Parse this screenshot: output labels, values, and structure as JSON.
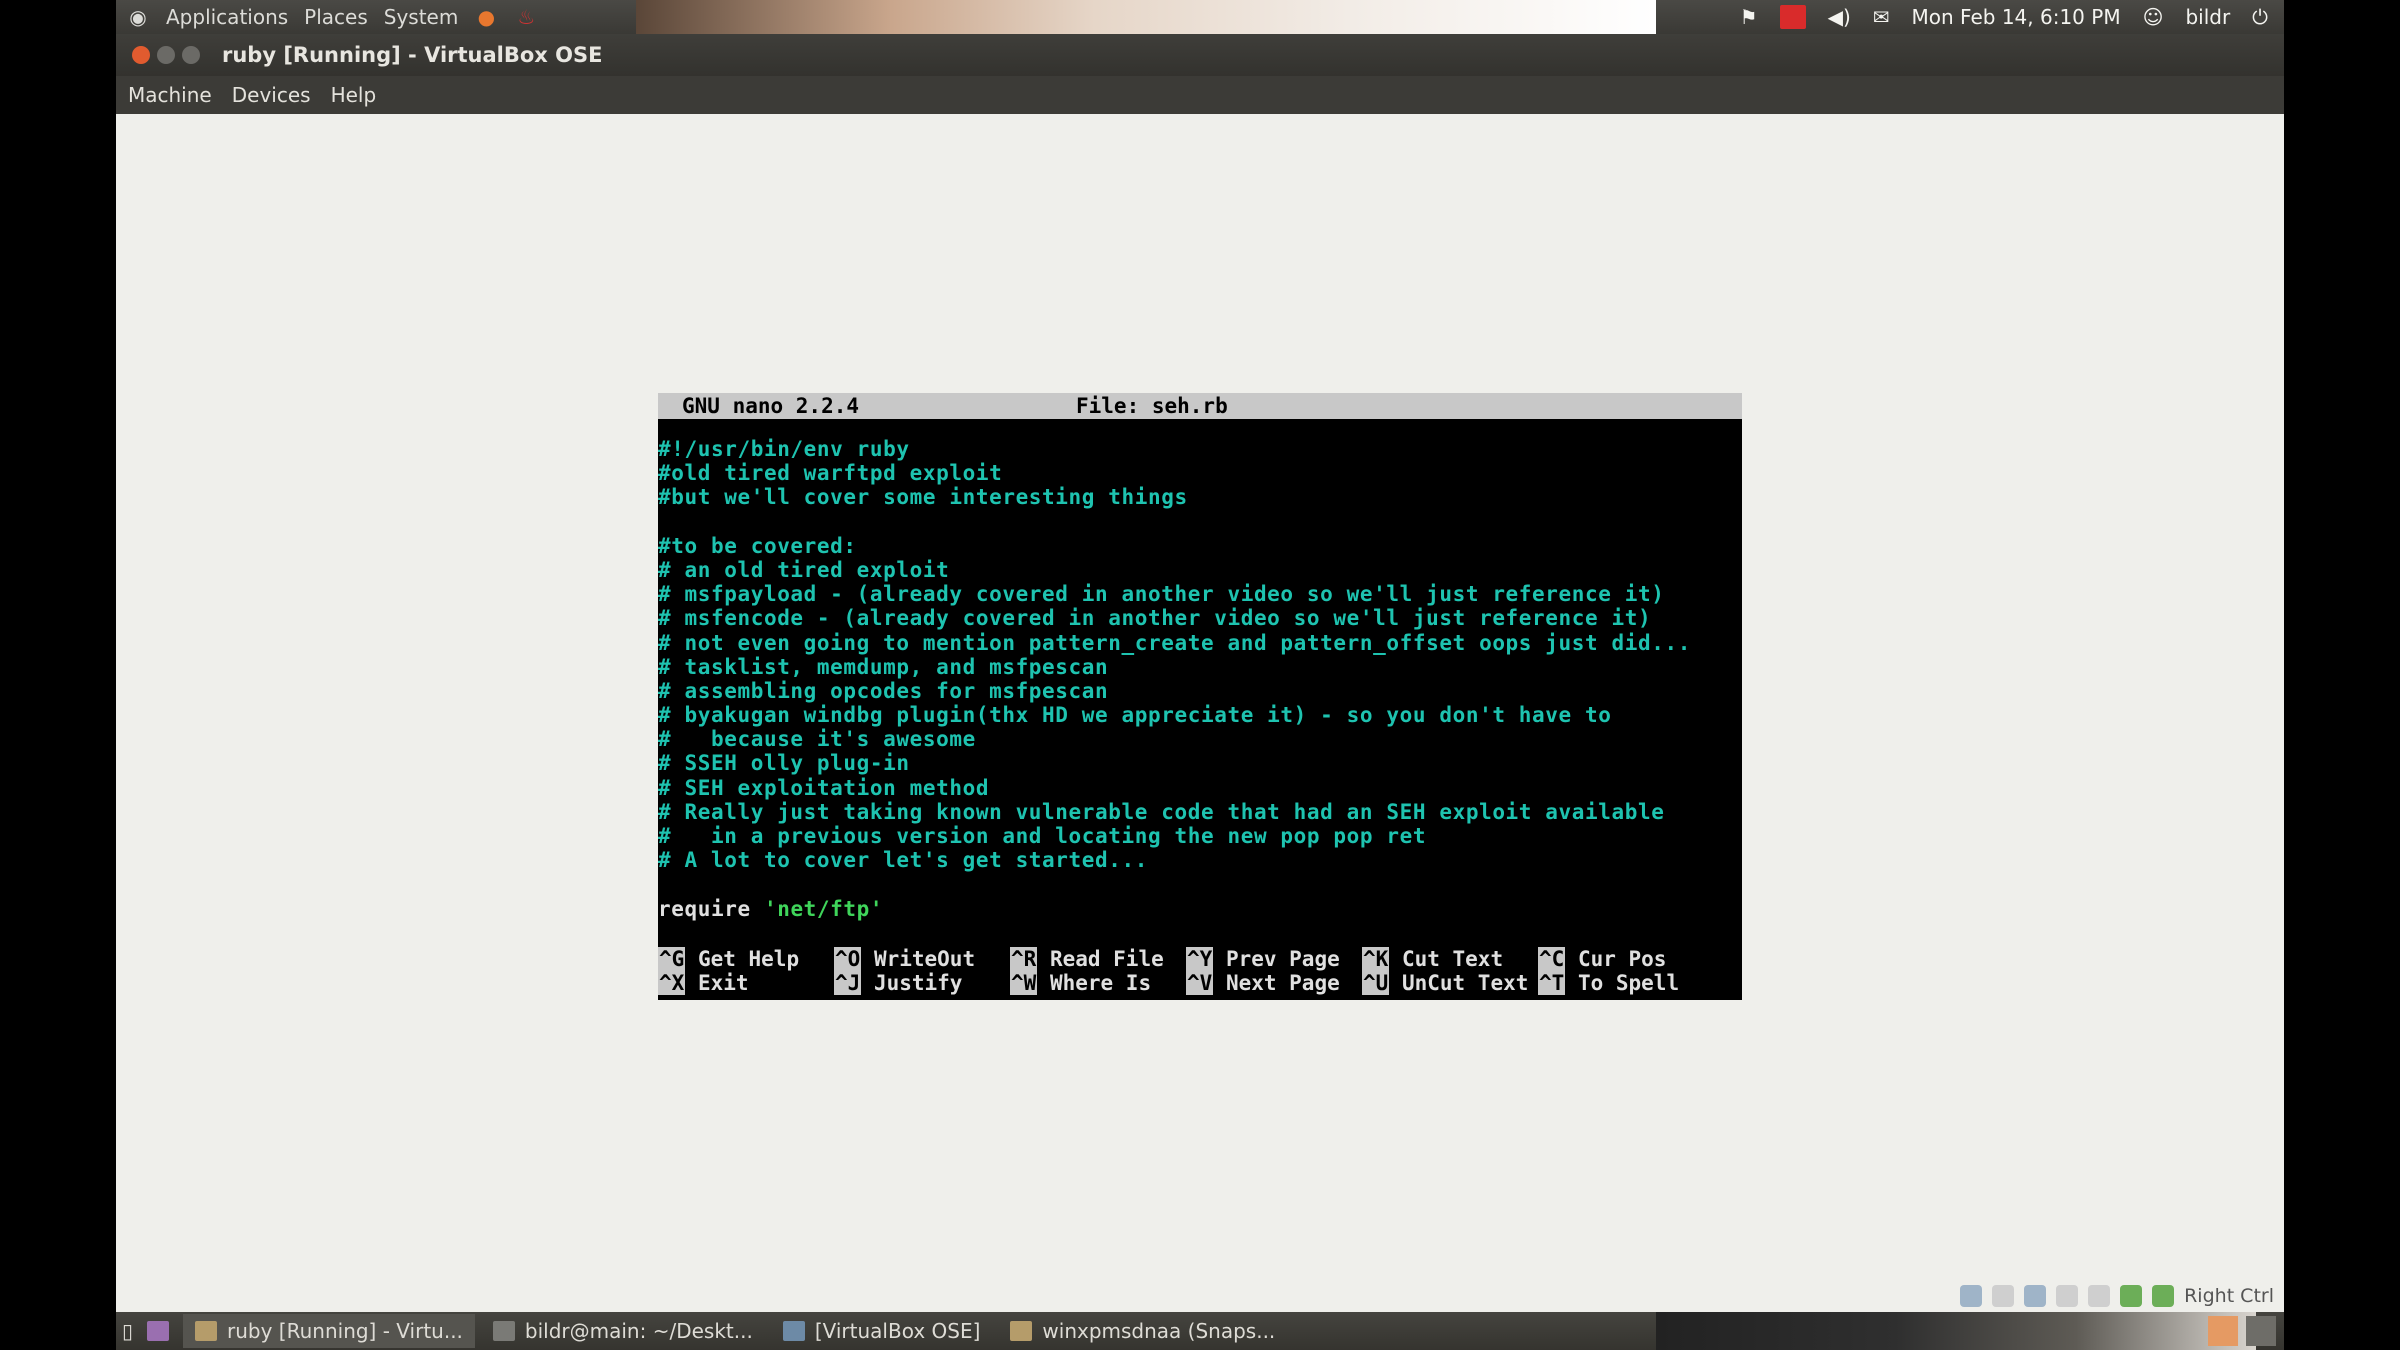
{
  "top_panel": {
    "menus": [
      "Applications",
      "Places",
      "System"
    ],
    "clock": "Mon Feb 14,  6:10 PM",
    "user": "bildr"
  },
  "window": {
    "title": "ruby [Running] - VirtualBox OSE",
    "menu": [
      "Machine",
      "Devices",
      "Help"
    ]
  },
  "nano": {
    "version": "GNU nano 2.2.4",
    "file": "File: seh.rb",
    "lines": [
      "#!/usr/bin/env ruby",
      "#old tired warftpd exploit",
      "#but we'll cover some interesting things",
      "",
      "#to be covered:",
      "# an old tired exploit",
      "# msfpayload - (already covered in another video so we'll just reference it)",
      "# msfencode - (already covered in another video so we'll just reference it)",
      "# not even going to mention pattern_create and pattern_offset oops just did...",
      "# tasklist, memdump, and msfpescan",
      "# assembling opcodes for msfpescan",
      "# byakugan windbg plugin(thx HD we appreciate it) - so you don't have to",
      "#   because it's awesome",
      "# SSEH olly plug-in",
      "# SEH exploitation method",
      "# Really just taking known vulnerable code that had an SEH exploit available",
      "#   in a previous version and locating the new pop pop ret",
      "# A lot to cover let's get started...",
      "",
      "require 'net/ftp'"
    ],
    "shortcuts_row1": [
      {
        "key": "^G",
        "label": "Get Help"
      },
      {
        "key": "^O",
        "label": "WriteOut"
      },
      {
        "key": "^R",
        "label": "Read File"
      },
      {
        "key": "^Y",
        "label": "Prev Page"
      },
      {
        "key": "^K",
        "label": "Cut Text"
      },
      {
        "key": "^C",
        "label": "Cur Pos"
      }
    ],
    "shortcuts_row2": [
      {
        "key": "^X",
        "label": "Exit"
      },
      {
        "key": "^J",
        "label": "Justify"
      },
      {
        "key": "^W",
        "label": "Where Is"
      },
      {
        "key": "^V",
        "label": "Next Page"
      },
      {
        "key": "^U",
        "label": "UnCut Text"
      },
      {
        "key": "^T",
        "label": "To Spell"
      }
    ]
  },
  "vb_status": {
    "host_key": "Right Ctrl"
  },
  "taskbar": {
    "tasks": [
      "ruby [Running] - Virtu...",
      "bildr@main: ~/Deskt...",
      "[VirtualBox OSE]",
      "winxpmsdnaa (Snaps..."
    ]
  }
}
